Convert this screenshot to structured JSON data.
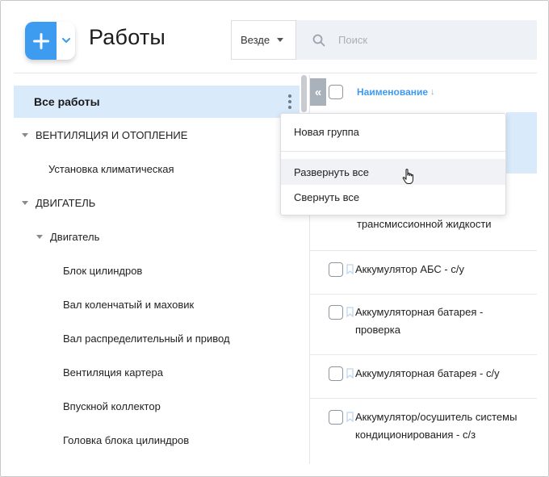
{
  "header": {
    "title": "Работы",
    "scope_select": "Везде",
    "search_placeholder": "Поиск"
  },
  "tree": {
    "all_label": "Все работы",
    "items": [
      {
        "label": "ВЕНТИЛЯЦИЯ И ОТОПЛЕНИЕ",
        "level": 0,
        "expanded": true
      },
      {
        "label": "Установка климатическая",
        "level": 1
      },
      {
        "label": "ДВИГАТЕЛЬ",
        "level": 0,
        "expanded": true
      },
      {
        "label": "Двигатель",
        "level": 1,
        "expanded": true
      },
      {
        "label": "Блок цилиндров",
        "level": 2
      },
      {
        "label": "Вал коленчатый и маховик",
        "level": 2
      },
      {
        "label": "Вал распределительный и привод",
        "level": 2
      },
      {
        "label": "Вентиляция картера",
        "level": 2
      },
      {
        "label": "Впускной коллектор",
        "level": 2
      },
      {
        "label": "Головка блока цилиндров",
        "level": 2
      }
    ]
  },
  "list": {
    "column_title": "Наименование",
    "sort_indicator": "↓",
    "partial_row_text": "трансмиссионной жидкости",
    "rows": [
      {
        "name": "Аккумулятор АБС - с/у"
      },
      {
        "name": "Аккумуляторная батарея - проверка"
      },
      {
        "name": "Аккумуляторная батарея - с/у"
      },
      {
        "name": "Аккумулятор/осушитель системы кондиционирования - с/з"
      }
    ]
  },
  "menu": {
    "items": [
      {
        "label": "Новая группа"
      },
      {
        "label": "Развернуть все",
        "hovered": true
      },
      {
        "label": "Свернуть все"
      }
    ]
  },
  "colors": {
    "accent": "#3d9bf0",
    "selection": "#d9ebfb",
    "search_bg": "#eef1f5"
  },
  "icons": [
    "plus-icon",
    "chevron-down-icon",
    "search-icon",
    "kebab-menu-icon",
    "double-chevron-left-icon",
    "bookmark-icon",
    "pointer-hand-icon"
  ]
}
